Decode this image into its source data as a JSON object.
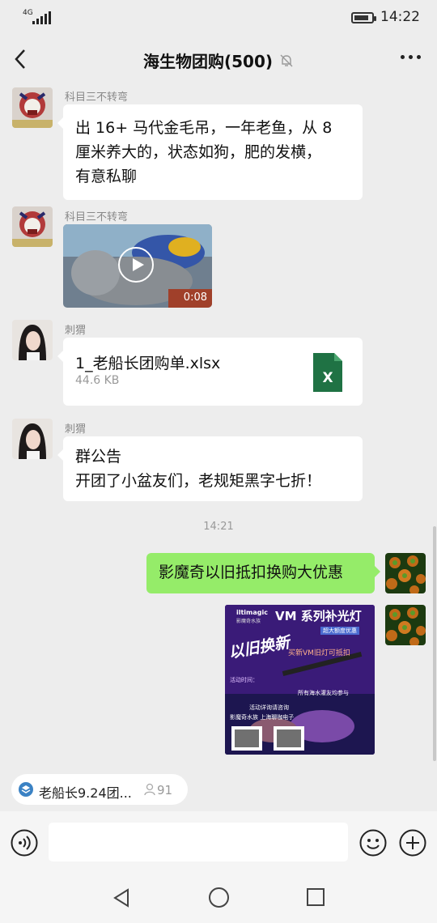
{
  "status_bar": {
    "network": "4G",
    "time": "14:22"
  },
  "header": {
    "title": "海生物团购(500)"
  },
  "messages": {
    "m1": {
      "sender": "科目三不转弯",
      "text_lines": [
        "出 16+ 马代金毛吊，一年老鱼，从 8",
        "厘米养大的，状态如狗，肥的发横，",
        "有意私聊"
      ]
    },
    "m2": {
      "sender": "科目三不转弯",
      "video_duration": "0:08"
    },
    "m3": {
      "sender": "刺猬",
      "file_name": "1_老船长团购单.xlsx",
      "file_size": "44.6 KB",
      "file_badge": "X"
    },
    "m4": {
      "sender": "刺猬",
      "text_lines": [
        "群公告",
        "开团了小盆友们，老规矩黑字七折！"
      ]
    },
    "timestamp": "14:21",
    "m5": {
      "text": "影魔奇以旧抵扣换购大优惠"
    },
    "m6": {
      "poster_brand": "iltimagic",
      "poster_brand_sub": "影魔奇水族",
      "poster_headline": "VM 系列补光灯",
      "poster_tag": "超大额度优惠",
      "poster_big": "以旧换新",
      "poster_offer": "买新VM旧灯可抵扣",
      "poster_lines": [
        "活动时间：",
        "所有海水灌友均参与",
        "活动详询请咨询",
        "影魔奇水族  上海聊咖电子"
      ]
    }
  },
  "pinned": {
    "label": "老船长9.24团...",
    "count": "91"
  },
  "colors": {
    "bg": "#ededed",
    "my_bubble": "#95ec69",
    "excel_green": "#1f7244"
  },
  "icons": [
    "back-icon",
    "mute-bell-icon",
    "more-icon",
    "voice-icon",
    "emoji-icon",
    "plus-icon",
    "nav-back-icon",
    "nav-home-icon",
    "nav-recent-icon",
    "play-icon",
    "excel-file-icon"
  ]
}
